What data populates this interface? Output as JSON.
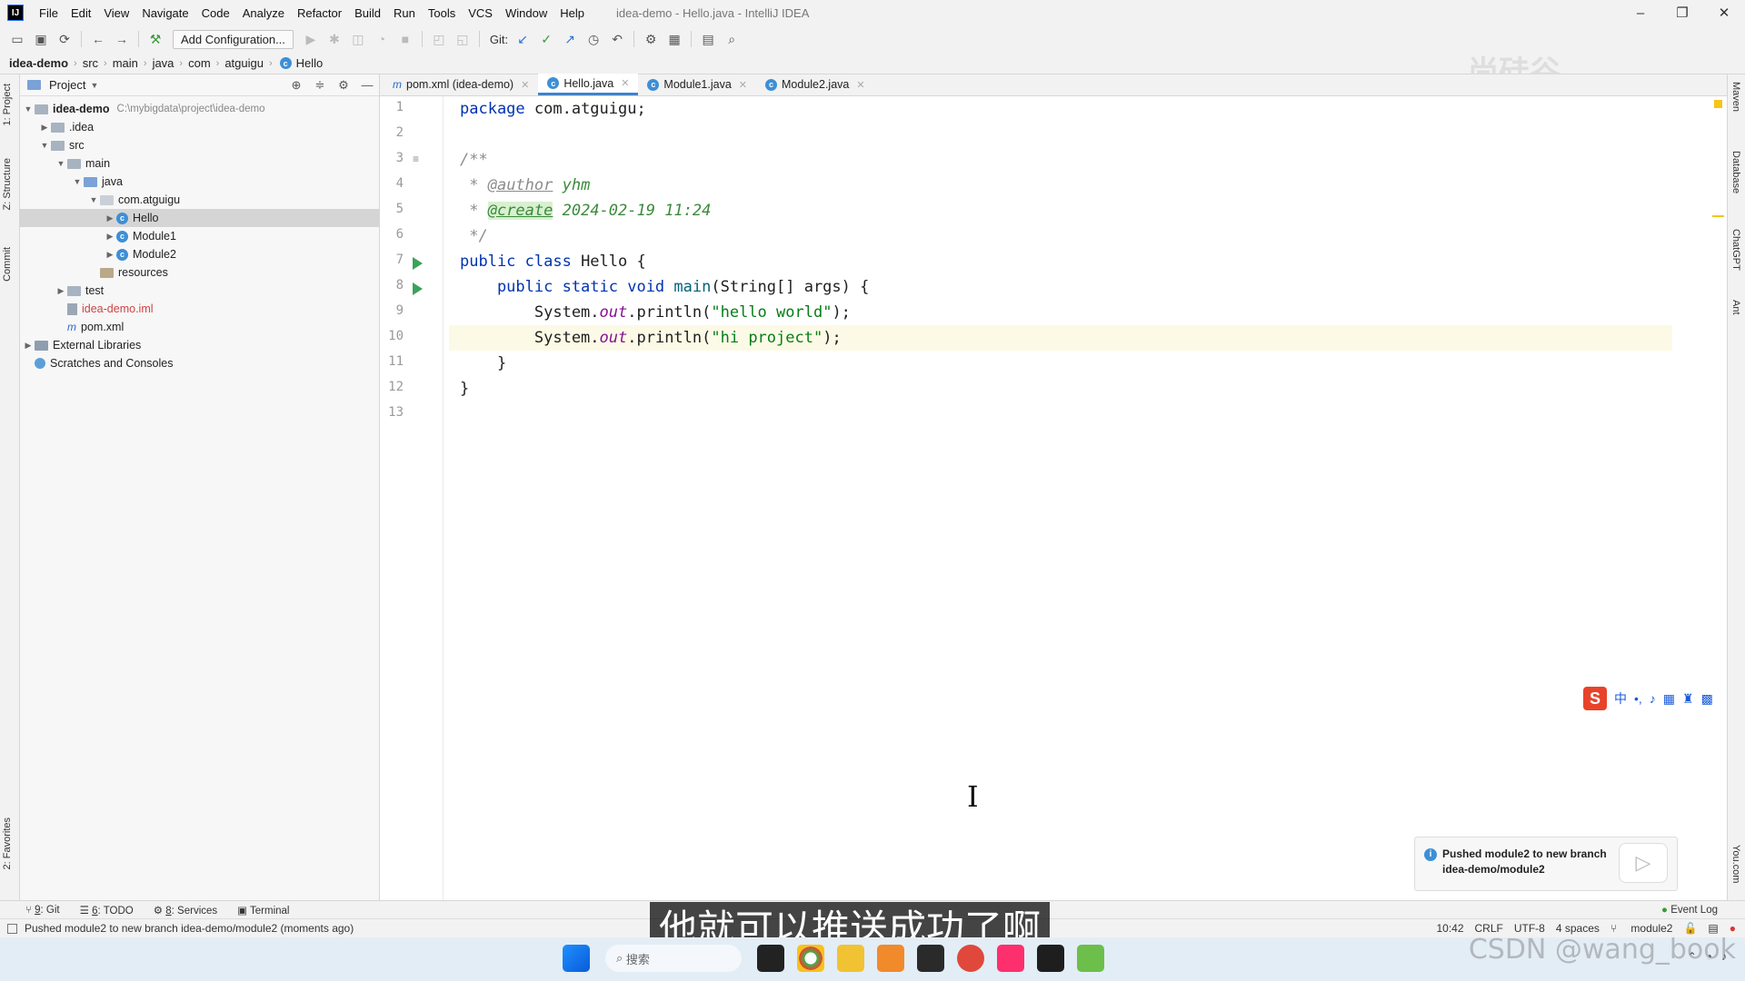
{
  "window": {
    "app_logo": "IJ",
    "title": "idea-demo - Hello.java - IntelliJ IDEA",
    "controls": [
      "–",
      "❐",
      "✕"
    ]
  },
  "menu": [
    {
      "label": "File"
    },
    {
      "label": "Edit"
    },
    {
      "label": "View"
    },
    {
      "label": "Navigate"
    },
    {
      "label": "Code"
    },
    {
      "label": "Analyze"
    },
    {
      "label": "Refactor"
    },
    {
      "label": "Build"
    },
    {
      "label": "Run"
    },
    {
      "label": "Tools"
    },
    {
      "label": "VCS"
    },
    {
      "label": "Window"
    },
    {
      "label": "Help"
    }
  ],
  "toolbar": {
    "add_configuration": "Add Configuration...",
    "git_label": "Git:"
  },
  "breadcrumb": [
    "idea-demo",
    "src",
    "main",
    "java",
    "com",
    "atguigu",
    "Hello"
  ],
  "project_panel": {
    "title": "Project",
    "tree": [
      {
        "label": "idea-demo",
        "path": "C:\\mybigdata\\project\\idea-demo",
        "bold": true
      },
      {
        "label": ".idea"
      },
      {
        "label": "src"
      },
      {
        "label": "main"
      },
      {
        "label": "java"
      },
      {
        "label": "com.atguigu"
      },
      {
        "label": "Hello"
      },
      {
        "label": "Module1"
      },
      {
        "label": "Module2"
      },
      {
        "label": "resources"
      },
      {
        "label": "test"
      },
      {
        "label": "idea-demo.iml"
      },
      {
        "label": "pom.xml"
      },
      {
        "label": "External Libraries"
      },
      {
        "label": "Scratches and Consoles"
      }
    ]
  },
  "left_stripe": [
    "1: Project",
    "Z: Structure",
    "Commit",
    "2: Favorites"
  ],
  "right_stripe": [
    "Maven",
    "Database",
    "ChatGPT",
    "Ant",
    "You.com"
  ],
  "editor": {
    "tabs": [
      {
        "label": "pom.xml (idea-demo)",
        "icon": "m"
      },
      {
        "label": "Hello.java",
        "icon": "c"
      },
      {
        "label": "Module1.java",
        "icon": "c"
      },
      {
        "label": "Module2.java",
        "icon": "c"
      }
    ],
    "active_tab": "Hello.java",
    "line_numbers": [
      "1",
      "2",
      "3",
      "4",
      "5",
      "6",
      "7",
      "8",
      "9",
      "10",
      "11",
      "12",
      "13"
    ],
    "lines": {
      "l1_kw": "package",
      "l1_rest": " com.atguigu;",
      "l3": "/**",
      "l4_star": " * ",
      "l4_tag": "@author",
      "l4_val": " yhm",
      "l5_star": " * ",
      "l5_tag": "@create",
      "l5_val": " 2024-02-19 11:24",
      "l6": " */",
      "l7_kw": "public class",
      "l7_rest": " Hello {",
      "l8_kw": "    public static void",
      "l8_fn": " main",
      "l8_rest": "(String[] args) {",
      "l9_a": "        System.",
      "l9_fld": "out",
      "l9_b": ".println(",
      "l9_str": "\"hello world\"",
      "l9_c": ");",
      "l10_a": "        System.",
      "l10_fld": "out",
      "l10_b": ".println(",
      "l10_str": "\"hi project\"",
      "l10_c": ");",
      "l11": "    }",
      "l12": "}"
    }
  },
  "notification": {
    "line1": "Pushed module2 to new branch",
    "line2": "idea-demo/module2"
  },
  "bottom_tools": [
    {
      "num": "9",
      "label": ": Git"
    },
    {
      "num": "6",
      "label": ": TODO"
    },
    {
      "num": "8",
      "label": ": Services"
    },
    {
      "num": "",
      "label": "Terminal"
    }
  ],
  "event_log": "Event Log",
  "status": {
    "message": "Pushed module2 to new branch idea-demo/module2 (moments ago)",
    "position": "10:42",
    "line_sep": "CRLF",
    "encoding": "UTF-8",
    "indent": "4 spaces",
    "branch": "module2"
  },
  "subtitle": "他就可以推送成功了啊",
  "overlay_watermark_top": "尚硅谷",
  "watermark": "CSDN @wang_book",
  "taskbar": {
    "search_placeholder": "搜索"
  },
  "colors": {
    "keyword": "#0033b3",
    "string": "#067d17",
    "comment": "#8c8c8c",
    "accent_tab": "#4083c9",
    "run_arrow": "#3aa35a"
  }
}
